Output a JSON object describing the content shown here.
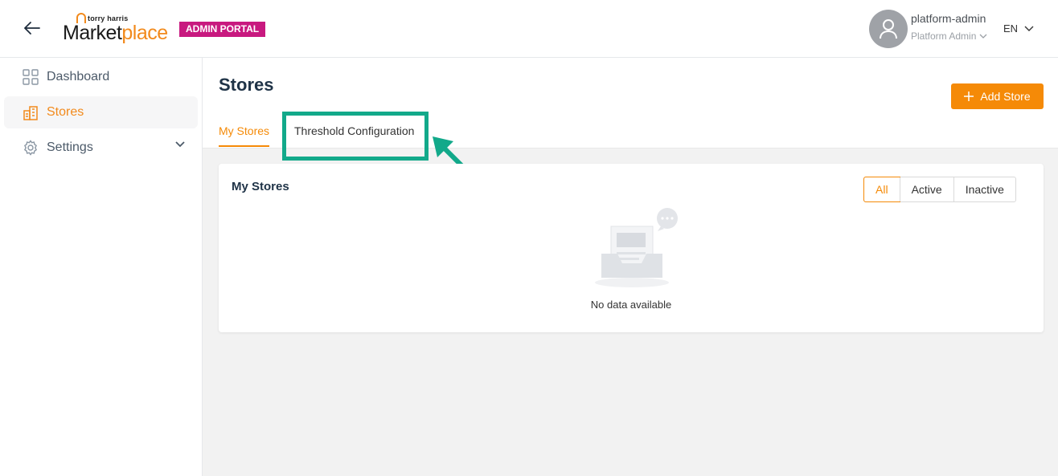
{
  "header": {
    "brand_small": "torry harris",
    "brand_big_prefix": "Market",
    "brand_big_accent": "place",
    "portal_badge": "ADMIN PORTAL",
    "user_name": "platform-admin",
    "user_role": "Platform Admin",
    "language": "EN"
  },
  "sidebar": {
    "items": [
      {
        "label": "Dashboard",
        "icon": "grid-icon"
      },
      {
        "label": "Stores",
        "icon": "store-icon"
      },
      {
        "label": "Settings",
        "icon": "gear-icon"
      }
    ]
  },
  "main": {
    "title": "Stores",
    "add_button": "Add Store",
    "tabs": [
      {
        "label": "My Stores"
      },
      {
        "label": "Threshold Configuration"
      }
    ],
    "card": {
      "title": "My Stores",
      "filters": [
        "All",
        "Active",
        "Inactive"
      ],
      "empty_text": "No data available"
    }
  },
  "colors": {
    "accent": "#f58a07",
    "badge": "#c8197f",
    "highlight": "#12a98a"
  }
}
